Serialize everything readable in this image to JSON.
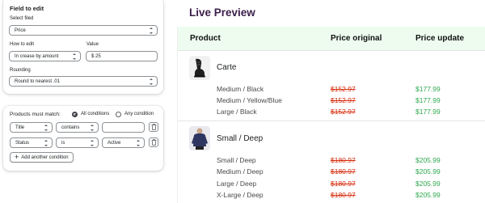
{
  "edit_card": {
    "title": "Field to edit",
    "select_field_label": "Select filed",
    "select_field_value": "Price",
    "how_label": "How to edit",
    "how_value": "In crease by amount",
    "value_label": "Value",
    "value_value": "$ 25",
    "rounding_label": "Rounding",
    "rounding_value": "Round to nearest .01"
  },
  "match_card": {
    "title": "Products must match:",
    "radio_all": "All conditions",
    "radio_any": "Any condition",
    "conditions": [
      {
        "field": "Title",
        "operator": "contains",
        "value": ""
      },
      {
        "field": "Status",
        "operator": "is",
        "value": "Active"
      }
    ],
    "add_label": "Add another condition"
  },
  "preview": {
    "title": "Live Preview",
    "headers": {
      "product": "Product",
      "orig": "Price original",
      "update": "Price update"
    },
    "groups": [
      {
        "name": "Carte",
        "thumb_icon": "snowboard-binding-icon",
        "rows": [
          {
            "variant": "Medium / Black",
            "orig": "$152.97",
            "update": "$177.99"
          },
          {
            "variant": "Medium / Yellow/Blue",
            "orig": "$152.97",
            "update": "$177.99"
          },
          {
            "variant": "Large / Black",
            "orig": "$152.97",
            "update": "$177.99"
          }
        ]
      },
      {
        "name": "Small / Deep",
        "thumb_icon": "sweater-icon",
        "rows": [
          {
            "variant": "Small / Deep",
            "orig": "$180.97",
            "update": "$205.99"
          },
          {
            "variant": "Medium / Deep",
            "orig": "$180.97",
            "update": "$205.99"
          },
          {
            "variant": "Large / Deep",
            "orig": "$180.97",
            "update": "$205.99"
          },
          {
            "variant": "X-Large / Deep",
            "orig": "$180.97",
            "update": "$205.99"
          }
        ]
      }
    ]
  },
  "colors": {
    "title": "#3b1f4a",
    "header_bg": "#eefcef",
    "strike": "#d72c0d",
    "green": "#2fa84f"
  }
}
